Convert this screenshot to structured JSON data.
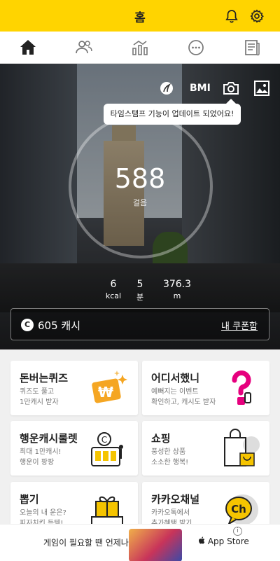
{
  "header": {
    "title": "홈"
  },
  "icons": {
    "bell": "bell-icon",
    "settings": "gear-icon",
    "home": "home-icon",
    "friends": "friends-icon",
    "stats": "chart-icon",
    "chat": "chat-icon",
    "news": "news-icon",
    "theme": "leaf-icon",
    "camera": "camera-icon",
    "gallery": "image-icon"
  },
  "hero": {
    "bmi_label": "BMI",
    "tooltip": "타임스탬프 기능이 업데이트 되었어요!",
    "steps": "588",
    "steps_label": "걸음",
    "stats": [
      {
        "value": "6",
        "unit": "kcal"
      },
      {
        "value": "5",
        "unit": "분"
      },
      {
        "value": "376.3",
        "unit": "m"
      }
    ],
    "cash": {
      "coin": "C",
      "text": "605 캐시",
      "coupon_link": "내 쿠폰함"
    }
  },
  "cards": [
    {
      "title": "돈버는퀴즈",
      "lines": [
        "퀴즈도 풀고",
        "1만캐시 받자"
      ]
    },
    {
      "title": "어디서했니",
      "lines": [
        "예뻐지는 이벤트",
        "확인하고, 캐시도 받자"
      ]
    },
    {
      "title": "행운캐시룰렛",
      "lines": [
        "최대 1만캐시!",
        "행운이 팡팡"
      ]
    },
    {
      "title": "쇼핑",
      "lines": [
        "풍성한 상품",
        "소소한 행복!"
      ]
    },
    {
      "title": "뽑기",
      "lines": [
        "오늘의 내 운은?",
        "피자치킨 득템!"
      ]
    },
    {
      "title": "카카오채널",
      "lines": [
        "카카오톡에서",
        "추가혜택 받기"
      ]
    }
  ],
  "ad": {
    "text": "게임이 필요할 땐 언제나",
    "store": " App Store",
    "info": "i"
  },
  "colors": {
    "brand_yellow": "#ffd400",
    "quiz_orange": "#f5a623",
    "pink": "#e6007e"
  }
}
